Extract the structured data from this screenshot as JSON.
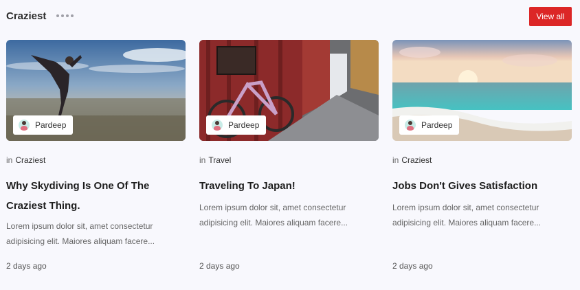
{
  "section": {
    "title": "Craziest",
    "view_all_label": "View all",
    "brand_color": "#dc2626"
  },
  "cards": [
    {
      "author": "Pardeep",
      "in_label": "in",
      "category": "Craziest",
      "title": "Why Skydiving Is One Of The Craziest Thing.",
      "excerpt": "Lorem ipsum dolor sit, amet consectetur adipisicing elit. Maiores aliquam facere...",
      "time": "2 days ago"
    },
    {
      "author": "Pardeep",
      "in_label": "in",
      "category": "Travel",
      "title": "Traveling To Japan!",
      "excerpt": "Lorem ipsum dolor sit, amet consectetur adipisicing elit. Maiores aliquam facere...",
      "time": "2 days ago"
    },
    {
      "author": "Pardeep",
      "in_label": "in",
      "category": "Craziest",
      "title": "Jobs Don't Gives Satisfaction",
      "excerpt": "Lorem ipsum dolor sit, amet consectetur adipisicing elit. Maiores aliquam facere...",
      "time": "2 days ago"
    }
  ]
}
